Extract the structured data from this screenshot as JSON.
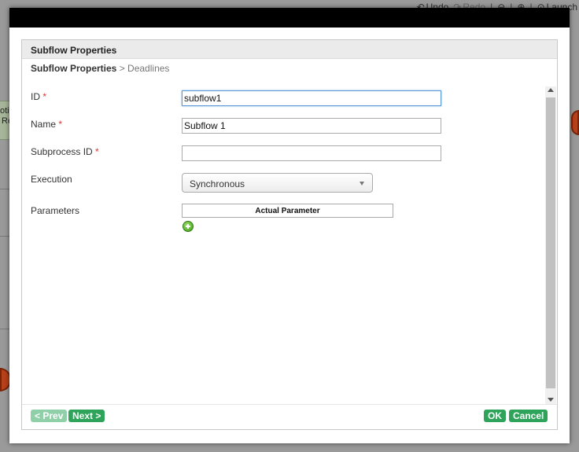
{
  "background_toolbar": {
    "undo_label": "Undo",
    "redo_label": "Redo",
    "launch_label": "Launch"
  },
  "background_canvas": {
    "box_text_1": "oti",
    "box_text_2": "Re"
  },
  "dialog": {
    "panel_title": "Subflow Properties",
    "breadcrumb": {
      "current": "Subflow Properties",
      "separator": " > ",
      "next": "Deadlines"
    },
    "fields": {
      "id": {
        "label": "ID",
        "required_mark": "*",
        "value": "subflow1"
      },
      "name": {
        "label": "Name",
        "required_mark": "*",
        "value": "Subflow 1"
      },
      "subprocess_id": {
        "label": "Subprocess ID",
        "required_mark": "*",
        "value": ""
      },
      "execution": {
        "label": "Execution",
        "selected": "Synchronous"
      },
      "parameters": {
        "label": "Parameters",
        "column_header": "Actual Parameter"
      }
    },
    "buttons": {
      "prev": "< Prev",
      "next": "Next >",
      "ok": "OK",
      "cancel": "Cancel"
    }
  },
  "colors": {
    "button_green": "#2ea35a",
    "button_disabled": "#8fd0a8",
    "required_red": "#dd3333",
    "focus_blue": "#5b9bd5"
  }
}
